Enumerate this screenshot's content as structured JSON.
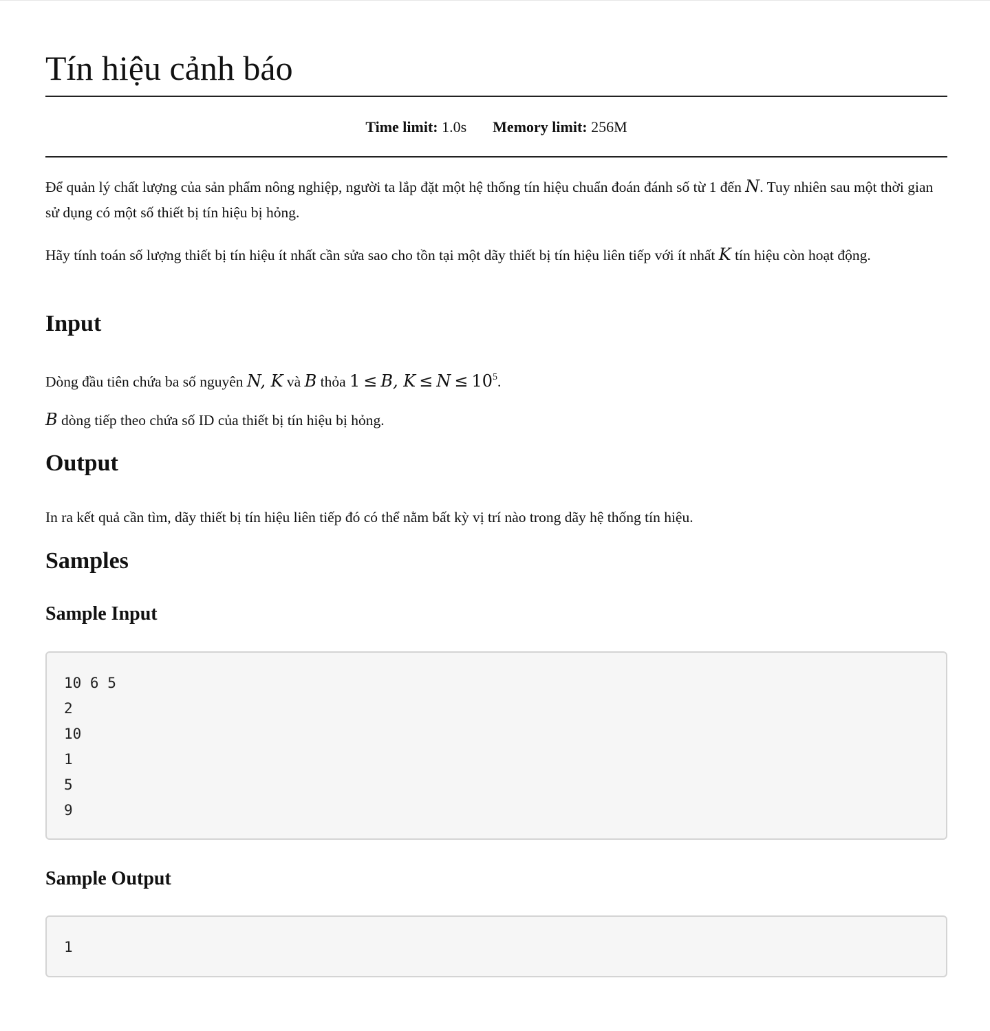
{
  "problem": {
    "title": "Tín hiệu cảnh báo",
    "time_limit_label": "Time limit:",
    "time_limit_value": "1.0s",
    "memory_limit_label": "Memory limit:",
    "memory_limit_value": "256M"
  },
  "statement": {
    "p1_text": "Để quản lý chất lượng của sản phẩm nông nghiệp, người ta lắp đặt một hệ thống tín hiệu chuẩn đoán đánh số từ 1 đến ",
    "p1_var": "N",
    "p1_text2": ". Tuy nhiên sau một thời gian sử dụng có một số thiết bị tín hiệu bị hỏng.",
    "p2_text": "Hãy tính toán số lượng thiết bị tín hiệu ít nhất cần sửa sao cho tồn tại một dãy thiết bị tín hiệu liên tiếp với ít nhất ",
    "p2_var": "K",
    "p2_text2": " tín hiệu còn hoạt động."
  },
  "input_section": {
    "heading": "Input",
    "line1_text": "Dòng đầu tiên chứa ba số nguyên ",
    "line1_vars": "N, K",
    "line1_and": " và ",
    "line1_var_b": "B",
    "line1_satisfy": " thỏa ",
    "line1_one": "1",
    "line1_le1": "≤",
    "line1_bk": "B, K",
    "line1_le2": "≤",
    "line1_n": "N",
    "line1_le3": "≤",
    "line1_ten": "10",
    "line1_exp": "5",
    "line1_end": ".",
    "line2_var": "B",
    "line2_text": " dòng tiếp theo chứa số ID của thiết bị tín hiệu bị hỏng."
  },
  "output_section": {
    "heading": "Output",
    "text": "In ra kết quả cần tìm, dãy thiết bị tín hiệu liên tiếp đó có thể nằm bất kỳ vị trí nào trong dãy hệ thống tín hiệu."
  },
  "samples": {
    "heading": "Samples",
    "input_heading": "Sample Input",
    "input_code": "10 6 5\n2\n10\n1\n5\n9",
    "output_heading": "Sample Output",
    "output_code": "1"
  }
}
